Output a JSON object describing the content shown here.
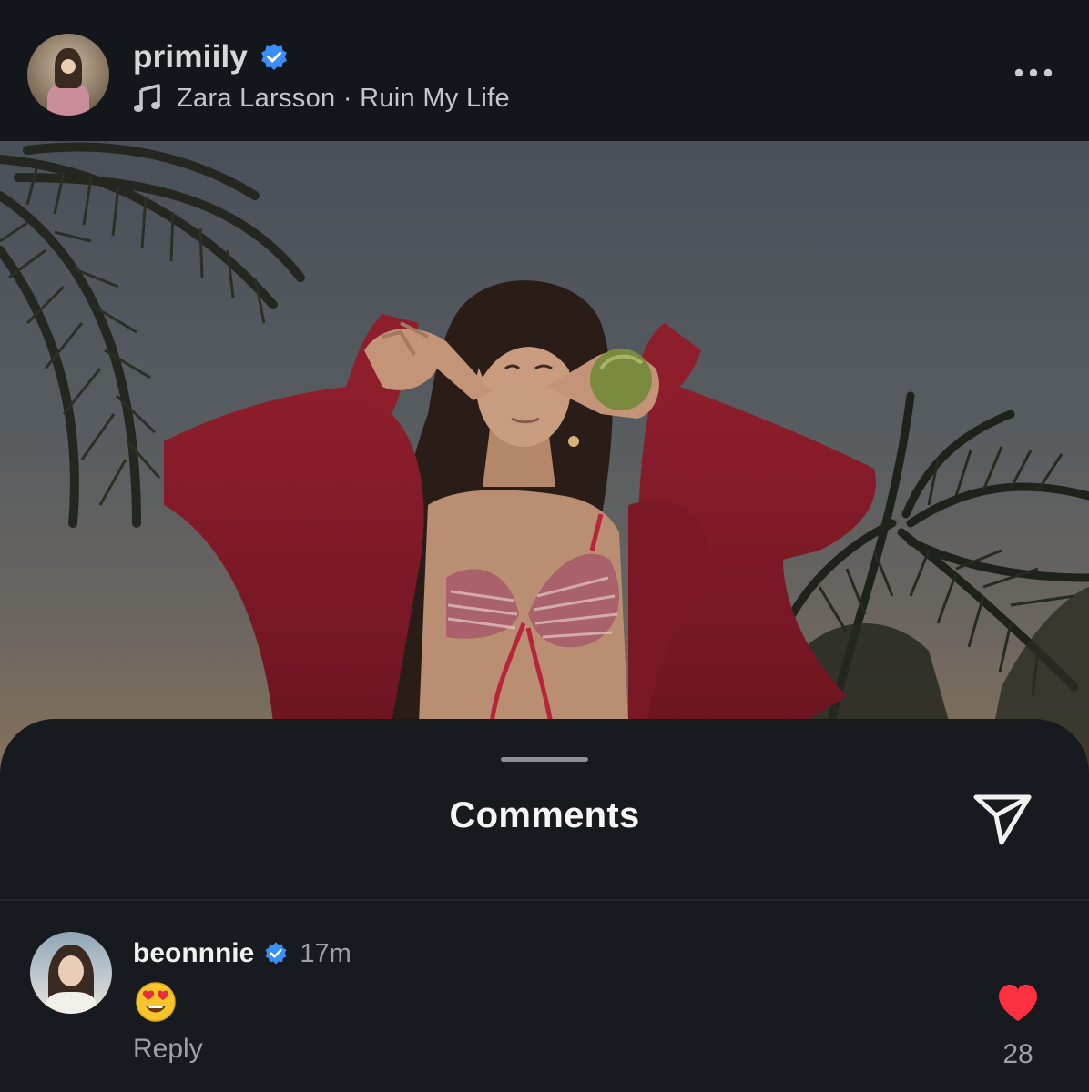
{
  "post": {
    "username": "primiily",
    "verified": true,
    "music": "Zara Larsson · Ruin My Life",
    "avatar_icon": "avatar-image",
    "more_icon": "more-options-icon"
  },
  "comments_sheet": {
    "title": "Comments",
    "share_icon": "send-icon",
    "comments": [
      {
        "username": "beonnnie",
        "verified": true,
        "time": "17m",
        "text": "😍",
        "reply_label": "Reply",
        "likes": "28",
        "liked": true
      }
    ]
  },
  "colors": {
    "verified_badge": "#3a8ef6",
    "like_heart": "#ff3040",
    "sheet_background": "#171a1e",
    "header_background": "#13171c"
  }
}
